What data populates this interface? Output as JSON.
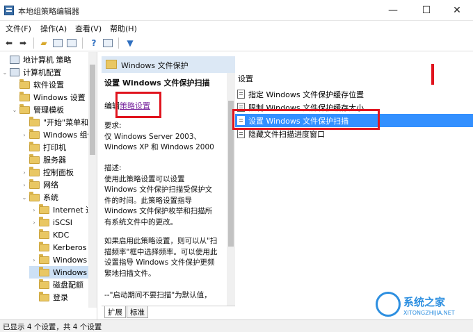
{
  "window": {
    "title": "本地组策略编辑器",
    "controls": [
      "minimize-icon",
      "maximize-icon",
      "close-icon"
    ]
  },
  "menu": [
    "文件(F)",
    "操作(A)",
    "查看(V)",
    "帮助(H)"
  ],
  "toolbar": {
    "icons": [
      "back-arrow-icon",
      "forward-arrow-icon",
      "folder-up-icon",
      "show-hide-tree-icon",
      "export-list-icon",
      "help-icon",
      "properties-icon",
      "filter-icon"
    ]
  },
  "tree": {
    "items": [
      {
        "label": "地计算机 策略",
        "indent": 0,
        "twisty": "",
        "icon": "computer-icon"
      },
      {
        "label": "计算机配置",
        "indent": 0,
        "twisty": "⌄",
        "icon": "computer-icon"
      },
      {
        "label": "软件设置",
        "indent": 1,
        "twisty": "",
        "icon": "folder-icon"
      },
      {
        "label": "Windows 设置",
        "indent": 1,
        "twisty": "",
        "icon": "folder-icon"
      },
      {
        "label": "管理模板",
        "indent": 1,
        "twisty": "⌄",
        "icon": "folder-icon"
      },
      {
        "label": "\"开始\"菜单和任务",
        "indent": 2,
        "twisty": "",
        "icon": "folder-icon"
      },
      {
        "label": "Windows 组件",
        "indent": 2,
        "twisty": "›",
        "icon": "folder-icon"
      },
      {
        "label": "打印机",
        "indent": 2,
        "twisty": "",
        "icon": "folder-icon"
      },
      {
        "label": "服务器",
        "indent": 2,
        "twisty": "",
        "icon": "folder-icon"
      },
      {
        "label": "控制面板",
        "indent": 2,
        "twisty": "›",
        "icon": "folder-icon"
      },
      {
        "label": "网络",
        "indent": 2,
        "twisty": "›",
        "icon": "folder-icon"
      },
      {
        "label": "系统",
        "indent": 2,
        "twisty": "⌄",
        "icon": "folder-icon"
      },
      {
        "label": "Internet 通信",
        "indent": 3,
        "twisty": "›",
        "icon": "folder-icon"
      },
      {
        "label": "iSCSI",
        "indent": 3,
        "twisty": "›",
        "icon": "folder-icon"
      },
      {
        "label": "KDC",
        "indent": 3,
        "twisty": "",
        "icon": "folder-icon"
      },
      {
        "label": "Kerberos",
        "indent": 3,
        "twisty": "",
        "icon": "folder-icon"
      },
      {
        "label": "Windows 时",
        "indent": 3,
        "twisty": "›",
        "icon": "folder-icon"
      },
      {
        "label": "Windows 文",
        "indent": 3,
        "twisty": "",
        "icon": "folder-icon",
        "selected": true
      },
      {
        "label": "磁盘配额",
        "indent": 3,
        "twisty": "",
        "icon": "folder-icon"
      },
      {
        "label": "登录",
        "indent": 3,
        "twisty": "",
        "icon": "folder-icon"
      }
    ]
  },
  "middle": {
    "header": "Windows 文件保护",
    "setting_title": "设置 Windows 文件保护扫描",
    "edit_prefix": "编辑",
    "edit_link": "策略设置",
    "requirements_lines": [
      "要求:",
      "仅 Windows Server 2003、",
      "Windows XP 和 Windows 2000"
    ],
    "description_lines": [
      "描述:",
      "使用此策略设置可以设置",
      "Windows 文件保护扫描受保护文",
      "件的时间。此策略设置指导",
      "Windows 文件保护枚举和扫描所",
      "有系统文件中的更改。"
    ],
    "extra_lines": [
      "如果启用此策略设置，则可以从\"扫",
      "描频率\"框中选择频率。可以使用此",
      "设置指导 Windows 文件保护更频",
      "繁地扫描文件。"
    ],
    "footer_lines": [
      "--\"启动期间不要扫描\"为默认值，"
    ],
    "tabs": [
      "扩展",
      "标准"
    ]
  },
  "right": {
    "column_header": "设置",
    "items": [
      {
        "label": "指定 Windows 文件保护缓存位置"
      },
      {
        "label": "限制 Windows 文件保护缓存大小"
      },
      {
        "label": "设置 Windows 文件保护扫描",
        "selected": true
      },
      {
        "label": "隐藏文件扫描进度窗口"
      }
    ]
  },
  "status": {
    "text": "已显示 4 个设置，共 4 个设置"
  },
  "watermark": {
    "text": "系统之家",
    "url": "XITONGZHIJIA.NET"
  }
}
